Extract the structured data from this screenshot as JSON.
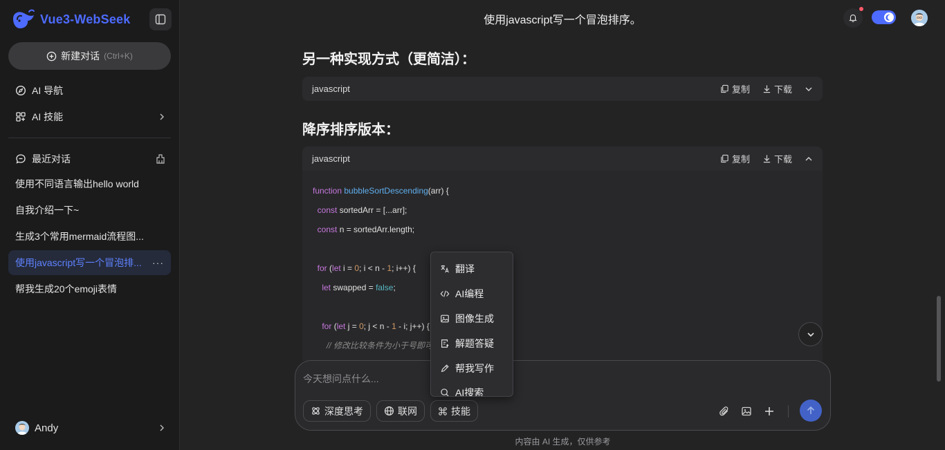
{
  "app": {
    "name": "Vue3-WebSeek",
    "brand_color": "#4d6bfe"
  },
  "sidebar": {
    "new_chat": {
      "label": "新建对话",
      "shortcut": "(Ctrl+K)"
    },
    "nav_label": "AI 导航",
    "skills_label": "AI 技能",
    "recent_label": "最近对话",
    "history": [
      {
        "title": "使用不同语言输出hello world",
        "active": false
      },
      {
        "title": "自我介绍一下~",
        "active": false
      },
      {
        "title": "生成3个常用mermaid流程图...",
        "active": false
      },
      {
        "title": "使用javascript写一个冒泡排...",
        "active": true,
        "more": "···"
      },
      {
        "title": "帮我生成20个emoji表情",
        "active": false
      }
    ],
    "user_name": "Andy"
  },
  "header": {
    "title": "使用javascript写一个冒泡排序。"
  },
  "content": {
    "heading_1": "另一种实现方式（更简洁）：",
    "heading_2": "降序排序版本：",
    "code_lang": "javascript",
    "copy_label": "复制",
    "download_label": "下载"
  },
  "composer": {
    "placeholder": "今天想问点什么...",
    "think_label": "深度思考",
    "web_label": "联网",
    "skill_label": "技能",
    "footer_note": "内容由 AI 生成，仅供参考"
  },
  "skill_menu": {
    "items": [
      {
        "label": "翻译",
        "icon": "translate-icon"
      },
      {
        "label": "AI编程",
        "icon": "code-icon"
      },
      {
        "label": "图像生成",
        "icon": "image-icon"
      },
      {
        "label": "解题答疑",
        "icon": "solve-icon"
      },
      {
        "label": "帮我写作",
        "icon": "pen-icon"
      },
      {
        "label": "AI搜索",
        "icon": "search-icon"
      }
    ]
  },
  "colors": {
    "accent": "#4d6bfe",
    "active_history_bg": "#252b3b",
    "notification_dot": "#ff5a6a"
  }
}
